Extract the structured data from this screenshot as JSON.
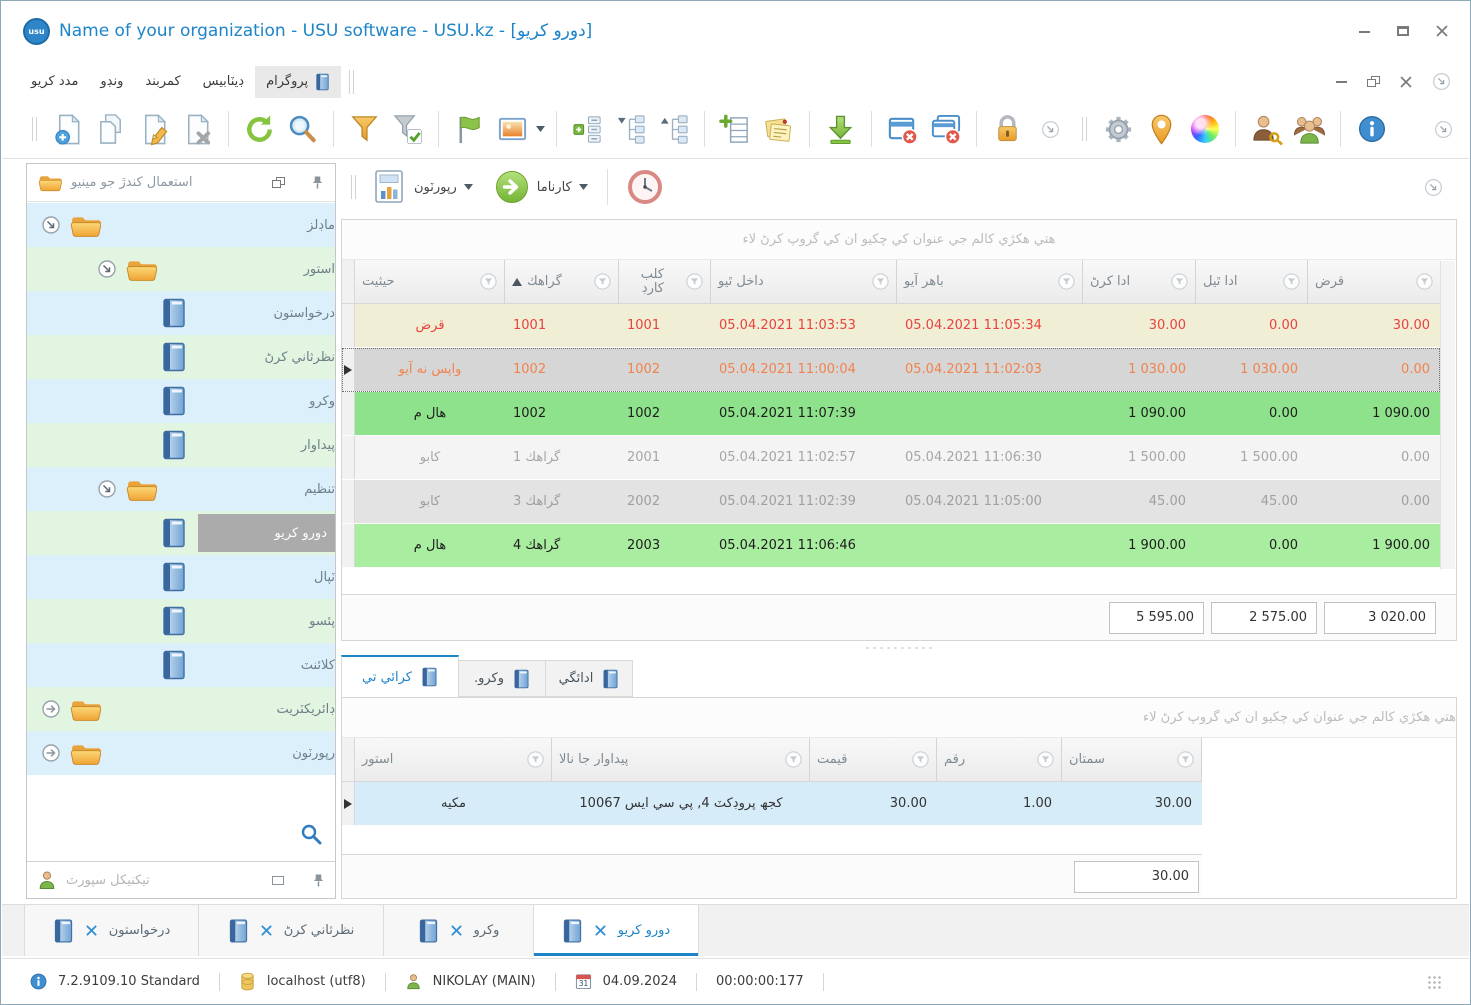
{
  "colors": {
    "accent": "#1d84c8",
    "row_debt_bg": "#f1eed6",
    "row_debt_text": "#e8433c",
    "row_selected_bg": "#d6d6d6",
    "row_selected_text": "#f0834e",
    "row_inhall_bg": "#8ee28b",
    "row_inhall2_bg": "#a9eda0",
    "tree_blue": "#dcf0fb",
    "tree_green": "#e2f5e0",
    "tree_selected": "#ababab"
  },
  "window": {
    "title": "Name of your organization - USU software - USU.kz - [دورو كريو]",
    "logo_text": "usu"
  },
  "menu": {
    "items": [
      "مدد كريو",
      "ونڊو",
      "كمربند",
      "ڊيٽابيس",
      "پروگرام"
    ]
  },
  "toolbar": {
    "icons": [
      "add-document",
      "copy-document",
      "edit-document",
      "delete-document",
      "refresh",
      "search",
      "filter",
      "apply-filter",
      "flag",
      "image",
      "expand-rows",
      "collapse-tree",
      "expand-tree",
      "add-row",
      "notes",
      "export",
      "close-window",
      "close-all-windows",
      "lock",
      "more",
      "settings",
      "location",
      "colors",
      "user-rights",
      "users",
      "info"
    ]
  },
  "ribbon": {
    "reports": "رپورٽون",
    "actions": "كارناما"
  },
  "sidebar": {
    "title": "استعمال كندڙ جو مينيو",
    "items": [
      {
        "label": "ماڊلز"
      },
      {
        "label": "استور"
      },
      {
        "label": "درخواستون"
      },
      {
        "label": "نظرثاني كرڻ"
      },
      {
        "label": "وكرو"
      },
      {
        "label": "پيداوار"
      },
      {
        "label": "تنظيم"
      },
      {
        "label": "دورو كريو",
        "selected": true
      },
      {
        "label": "ٽپال"
      },
      {
        "label": "پئسو"
      },
      {
        "label": "كلائنٽ"
      },
      {
        "label": "ڊائريكٽريت"
      },
      {
        "label": "رپورٽون"
      }
    ],
    "support_title": "تيكنيكل سپورٽ"
  },
  "grid": {
    "group_hint": "هتي هكڙي كالم جي عنوان كي چكيو ان كي گروپ كرڻ لاء",
    "columns": [
      "حيثيت",
      "گراهك",
      "كلب كارڊ",
      "داخل ٿيو",
      "باهر آيو",
      "ادا كرڻ",
      "ادا ٿيل",
      "قرض"
    ],
    "rows": [
      [
        "قرض",
        "1001",
        "1001",
        "05.04.2021 11:03:53",
        "05.04.2021 11:05:34",
        "30.00",
        "0.00",
        "30.00"
      ],
      [
        "واپس نه آيو",
        "1002",
        "1002",
        "05.04.2021 11:00:04",
        "05.04.2021 11:02:03",
        "1 030.00",
        "1 030.00",
        "0.00"
      ],
      [
        "هال م",
        "1002",
        "1002",
        "05.04.2021 11:07:39",
        "",
        "1 090.00",
        "0.00",
        "1 090.00"
      ],
      [
        "كابو",
        "گراهك 1",
        "2001",
        "05.04.2021 11:02:57",
        "05.04.2021 11:06:30",
        "1 500.00",
        "1 500.00",
        "0.00"
      ],
      [
        "كابو",
        "گراهك 3",
        "2002",
        "05.04.2021 11:02:39",
        "05.04.2021 11:05:00",
        "45.00",
        "45.00",
        "0.00"
      ],
      [
        "هال م",
        "گراهك 4",
        "2003",
        "05.04.2021 11:06:46",
        "",
        "1 900.00",
        "0.00",
        "1 900.00"
      ]
    ],
    "summary": [
      "5 595.00",
      "2 575.00",
      "3 020.00"
    ]
  },
  "detail_tabs": [
    "كرائي تي",
    "وكرو.",
    "ادائگي"
  ],
  "bgrid": {
    "group_hint": "هتي هكڙي كالم جي عنوان كي چكيو ان كي گروپ كرڻ لاء",
    "columns": [
      "استور",
      "پيداوار جا نالا",
      "قيمت",
      "رقم",
      "سمتان"
    ],
    "rows": [
      [
        "مكيه",
        "كجھ پروڊكٽ 4, پي سي ايس 10067",
        "30.00",
        "1.00",
        "30.00"
      ]
    ],
    "summary": "30.00"
  },
  "mdi_tabs": [
    "درخواستون",
    "نظرثاني كرڻ",
    "وكرو",
    "دورو كريو"
  ],
  "status": {
    "version": "7.2.9109.10 Standard",
    "database": "localhost (utf8)",
    "user": "NIKOLAY (MAIN)",
    "date": "04.09.2024",
    "timer": "00:00:00:177"
  }
}
